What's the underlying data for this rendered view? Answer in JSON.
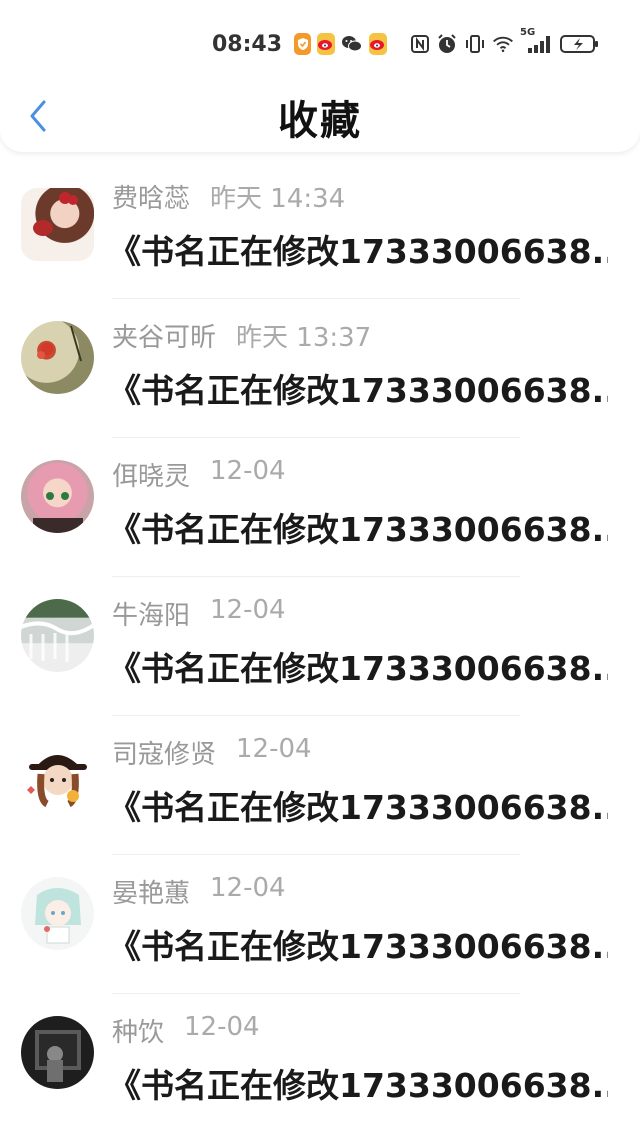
{
  "status": {
    "time": "08:43",
    "network": "5G"
  },
  "header": {
    "title": "收藏"
  },
  "items": [
    {
      "name": "费晗蕊",
      "time": "昨天 14:34",
      "title": "《书名正在修改17333006638..."
    },
    {
      "name": "夹谷可昕",
      "time": "昨天 13:37",
      "title": "《书名正在修改17333006638..."
    },
    {
      "name": "佴晓灵",
      "time": "12-04",
      "title": "《书名正在修改17333006638..."
    },
    {
      "name": "牛海阳",
      "time": "12-04",
      "title": "《书名正在修改17333006638..."
    },
    {
      "name": "司寇修贤",
      "time": "12-04",
      "title": "《书名正在修改17333006638..."
    },
    {
      "name": "晏艳蕙",
      "time": "12-04",
      "title": "《书名正在修改17333006638..."
    },
    {
      "name": "种饮",
      "time": "12-04",
      "title": "《书名正在修改17333006638..."
    }
  ],
  "colors": {
    "accent": "#4a90e2",
    "name_text": "#999999",
    "title_text": "#1a1a1a"
  }
}
